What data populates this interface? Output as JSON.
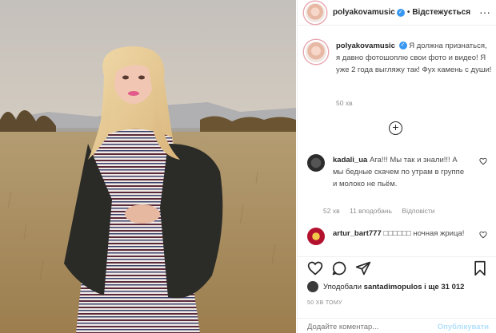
{
  "post": {
    "username": "polyakovamusic",
    "follow_label": "Відстежується",
    "dot": "•",
    "more_label": "···",
    "caption_text": "Я должна признаться, я давно фотошоплю свои фото и видео! Я уже 2 года выгляжу так! Фух камень с души!",
    "caption_time": "50 хв"
  },
  "load_more": {
    "label": "+"
  },
  "comments": [
    {
      "username": "kadali_ua",
      "text": "Ага!!! Мы так и знали!!! А мы бедные скачем по утрам в группе и молоко не пьём.",
      "time": "52 хв",
      "likes": "11 вподобань",
      "reply": "Відповісти"
    },
    {
      "username": "artur_bart777",
      "text": "□□□□□□ ночная жрица!"
    }
  ],
  "likes": {
    "prefix": "Уподобали",
    "user": "santadimopulos",
    "suffix": "і ще 31 012"
  },
  "time_ago": "50 ХВ ТОМУ",
  "add_comment": {
    "placeholder": "Додайте коментар...",
    "publish_label": "Опублікувати"
  },
  "icons": {
    "like": "heart-icon",
    "comment": "comment-icon",
    "share": "paper-plane-icon",
    "save": "bookmark-icon",
    "verified": "verified-badge-icon",
    "more": "more-options-icon"
  },
  "colors": {
    "accent": "#3897f0",
    "muted": "#8e8e8e",
    "publish_disabled": "#b2dffc",
    "border": "#efefef"
  }
}
